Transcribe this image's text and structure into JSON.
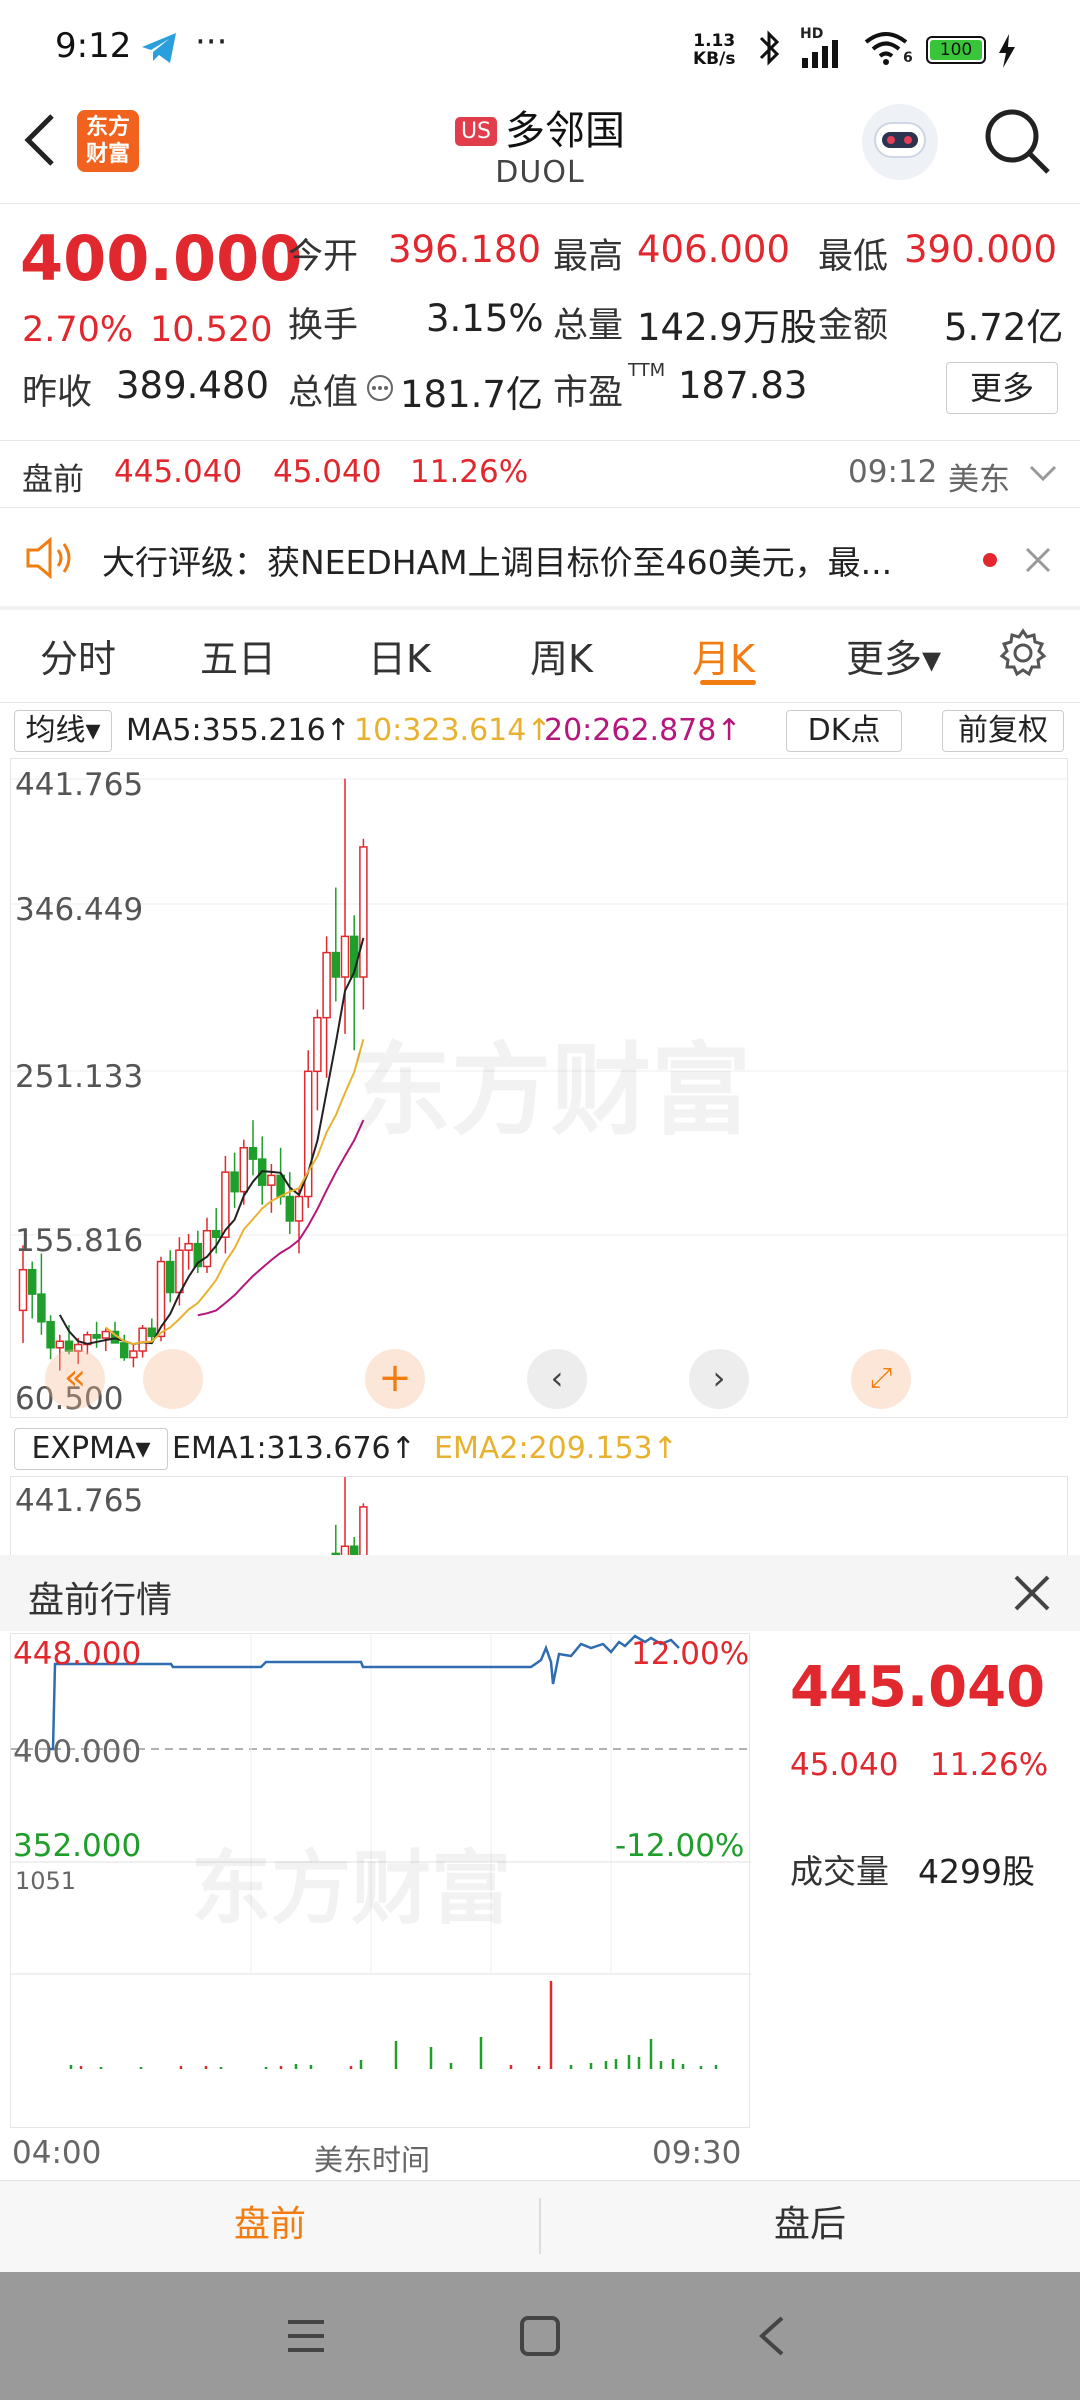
{
  "status_bar": {
    "time": "9:12",
    "ellipsis": "···",
    "net_speed_top": "1.13",
    "net_speed_bottom": "KB/s",
    "hd": "HD",
    "wifi_num": "6",
    "battery": "100"
  },
  "header": {
    "badge": "US",
    "name": "多邻国",
    "ticker": "DUOL",
    "brand_top": "东方",
    "brand_bottom": "财富"
  },
  "quote": {
    "price": "400.000",
    "change_pct": "2.70%",
    "change": "10.520",
    "prev_close_label": "昨收",
    "prev_close": "389.480",
    "open_label": "今开",
    "open": "396.180",
    "high_label": "最高",
    "high": "406.000",
    "low_label": "最低",
    "low": "390.000",
    "turnover_label": "换手",
    "turnover": "3.15%",
    "volume_label": "总量",
    "volume": "142.9万股",
    "amount_label": "金额",
    "amount": "5.72亿",
    "mktcap_label": "总值",
    "mktcap": "181.7亿",
    "pe_label": "市盈",
    "pe_sup": "TTM",
    "pe": "187.83",
    "more": "更多"
  },
  "premarket_row": {
    "label": "盘前",
    "price": "445.040",
    "change": "45.040",
    "pct": "11.26%",
    "time": "09:12",
    "market": "美东"
  },
  "news": {
    "text": "大行评级：获NEEDHAM上调目标价至460美元，最..."
  },
  "tabs": [
    "分时",
    "五日",
    "日K",
    "周K",
    "月K",
    "更多▾"
  ],
  "chart_toolbar": {
    "ma_select": "均线▾",
    "ma5": "MA5:355.216↑",
    "ma10": "10:323.614↑",
    "ma20": "20:262.878↑",
    "dk": "DK点",
    "adj": "前复权"
  },
  "kline_axis": [
    "441.765",
    "346.449",
    "251.133",
    "155.816",
    "60.500"
  ],
  "watermark": "东方财富",
  "expma": {
    "select": "EXPMA▾",
    "ema1": "EMA1:313.676↑",
    "ema2": "EMA2:209.153↑",
    "axis_top": "441.765"
  },
  "premarket_panel": {
    "title": "盘前行情",
    "y_high": "448.000",
    "y_mid": "400.000",
    "y_low": "352.000",
    "pct_high": "12.00%",
    "pct_low": "-12.00%",
    "vol_max": "1051",
    "x_start": "04:00",
    "x_mid": "美东时间",
    "x_end": "09:30",
    "price": "445.040",
    "change": "45.040",
    "pct": "11.26%",
    "vol_label": "成交量",
    "vol": "4299股"
  },
  "bottom_tabs": [
    "盘前",
    "盘后"
  ],
  "colors": {
    "up": "#e0282e",
    "down": "#1f9e2b",
    "accent": "#f07c12",
    "ma5": "#222222",
    "ma10": "#e8b230",
    "ma20": "#b5177d",
    "intraday": "#2f6db0"
  },
  "chart_data": {
    "type": "candlestick",
    "period": "monthly",
    "ylim": [
      60.5,
      441.765
    ],
    "ohlc": [
      [
        115,
        155,
        95,
        140
      ],
      [
        140,
        145,
        110,
        125
      ],
      [
        125,
        150,
        100,
        108
      ],
      [
        108,
        112,
        85,
        92
      ],
      [
        92,
        100,
        78,
        96
      ],
      [
        96,
        106,
        88,
        90
      ],
      [
        90,
        98,
        82,
        94
      ],
      [
        94,
        102,
        88,
        100
      ],
      [
        100,
        108,
        92,
        98
      ],
      [
        98,
        104,
        90,
        102
      ],
      [
        102,
        108,
        96,
        95
      ],
      [
        95,
        100,
        84,
        86
      ],
      [
        86,
        94,
        80,
        90
      ],
      [
        90,
        106,
        86,
        104
      ],
      [
        104,
        110,
        96,
        99
      ],
      [
        99,
        148,
        96,
        145
      ],
      [
        145,
        152,
        120,
        126
      ],
      [
        126,
        160,
        118,
        152
      ],
      [
        152,
        162,
        140,
        156
      ],
      [
        156,
        164,
        138,
        142
      ],
      [
        142,
        172,
        138,
        164
      ],
      [
        164,
        178,
        150,
        160
      ],
      [
        160,
        210,
        150,
        200
      ],
      [
        200,
        212,
        178,
        188
      ],
      [
        188,
        220,
        180,
        215
      ],
      [
        215,
        232,
        198,
        208
      ],
      [
        208,
        222,
        180,
        192
      ],
      [
        192,
        205,
        175,
        198
      ],
      [
        198,
        215,
        180,
        185
      ],
      [
        185,
        200,
        162,
        170
      ],
      [
        170,
        190,
        150,
        185
      ],
      [
        185,
        275,
        178,
        262
      ],
      [
        262,
        300,
        238,
        295
      ],
      [
        295,
        345,
        258,
        335
      ],
      [
        335,
        375,
        305,
        320
      ],
      [
        320,
        442,
        285,
        345
      ],
      [
        345,
        358,
        275,
        320
      ],
      [
        320,
        405,
        300,
        400
      ]
    ]
  }
}
